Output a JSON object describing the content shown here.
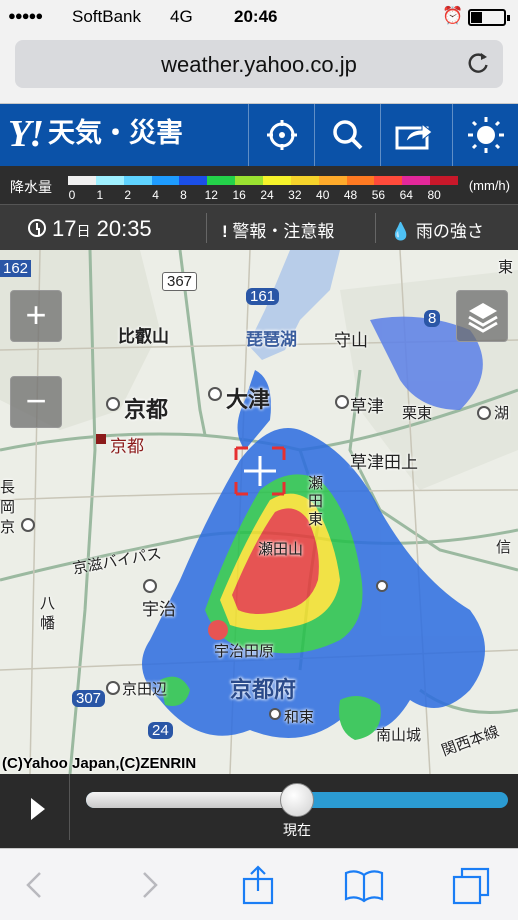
{
  "status_bar": {
    "signal": "●●●●●",
    "carrier": "SoftBank",
    "network": "4G",
    "time": "20:46",
    "alarm_icon": "alarm-clock-icon",
    "battery_icon": "battery-icon",
    "battery_level": 0.25
  },
  "browser": {
    "url": "weather.yahoo.co.jp",
    "reload_icon": "reload-icon"
  },
  "header": {
    "logo_y": "Y!",
    "logo_text": "天気・災害",
    "icons": [
      "location-icon",
      "search-icon",
      "share-icon",
      "weather-sun-icon"
    ]
  },
  "legend": {
    "label": "降水量",
    "unit": "(mm/h)",
    "ticks": [
      "0",
      "1",
      "2",
      "4",
      "8",
      "12",
      "16",
      "24",
      "32",
      "40",
      "48",
      "56",
      "64",
      "80"
    ],
    "colors": [
      "#f0f0f0",
      "#a0f0ff",
      "#5fd3ff",
      "#1e9cff",
      "#1b4fe8",
      "#24d24a",
      "#9be231",
      "#f6f32b",
      "#f6d32b",
      "#ffab2b",
      "#ff7a22",
      "#ff4b3b",
      "#e3289a",
      "#c8182a"
    ]
  },
  "info_row": {
    "day": "17",
    "day_suffix": "日",
    "time": "20:35",
    "warning_label": "警報・注意報",
    "rain_label": "雨の強さ"
  },
  "map": {
    "zoom_in": "+",
    "zoom_out": "−",
    "copyright": "(C)Yahoo Japan,(C)ZENRIN",
    "labels": {
      "hieizan": "比叡山",
      "biwako": "琵琶湖",
      "moriyama": "守山",
      "kyoto": "京都",
      "otsu": "大津",
      "kusatsu": "草津",
      "ritto": "栗東",
      "kyoto_station": "京都",
      "kusatsu_tanakami": "草津田上",
      "nagaokakyo_1": "長",
      "nagaokakyo_2": "岡",
      "nagaokakyo_3": "京",
      "keiji_bypass": "京滋バイパス",
      "uji": "宇治",
      "yawata_1": "八",
      "yawata_2": "幡",
      "seta_1": "瀬",
      "seta_2": "田",
      "seta_3": "東",
      "setayama": "瀬田山",
      "ujitawara": "宇治田原",
      "kyotofu": "京都府",
      "kyotanabe": "京田辺",
      "wazuka": "和束",
      "minamiyamashiro": "南山城",
      "shigaraki": "信",
      "kosei": "湖",
      "kansai_honsen": "関西本線",
      "road_161": "161",
      "road_367": "367",
      "road_307": "307",
      "road_24": "24",
      "road_162": "162",
      "road_8": "8",
      "higashi": "東"
    }
  },
  "player": {
    "play_icon": "play-icon",
    "now_label": "現在",
    "progress": 0.5
  },
  "toolbar": {
    "icons": [
      "back-icon",
      "forward-icon",
      "share-icon",
      "bookmarks-icon",
      "tabs-icon"
    ]
  }
}
